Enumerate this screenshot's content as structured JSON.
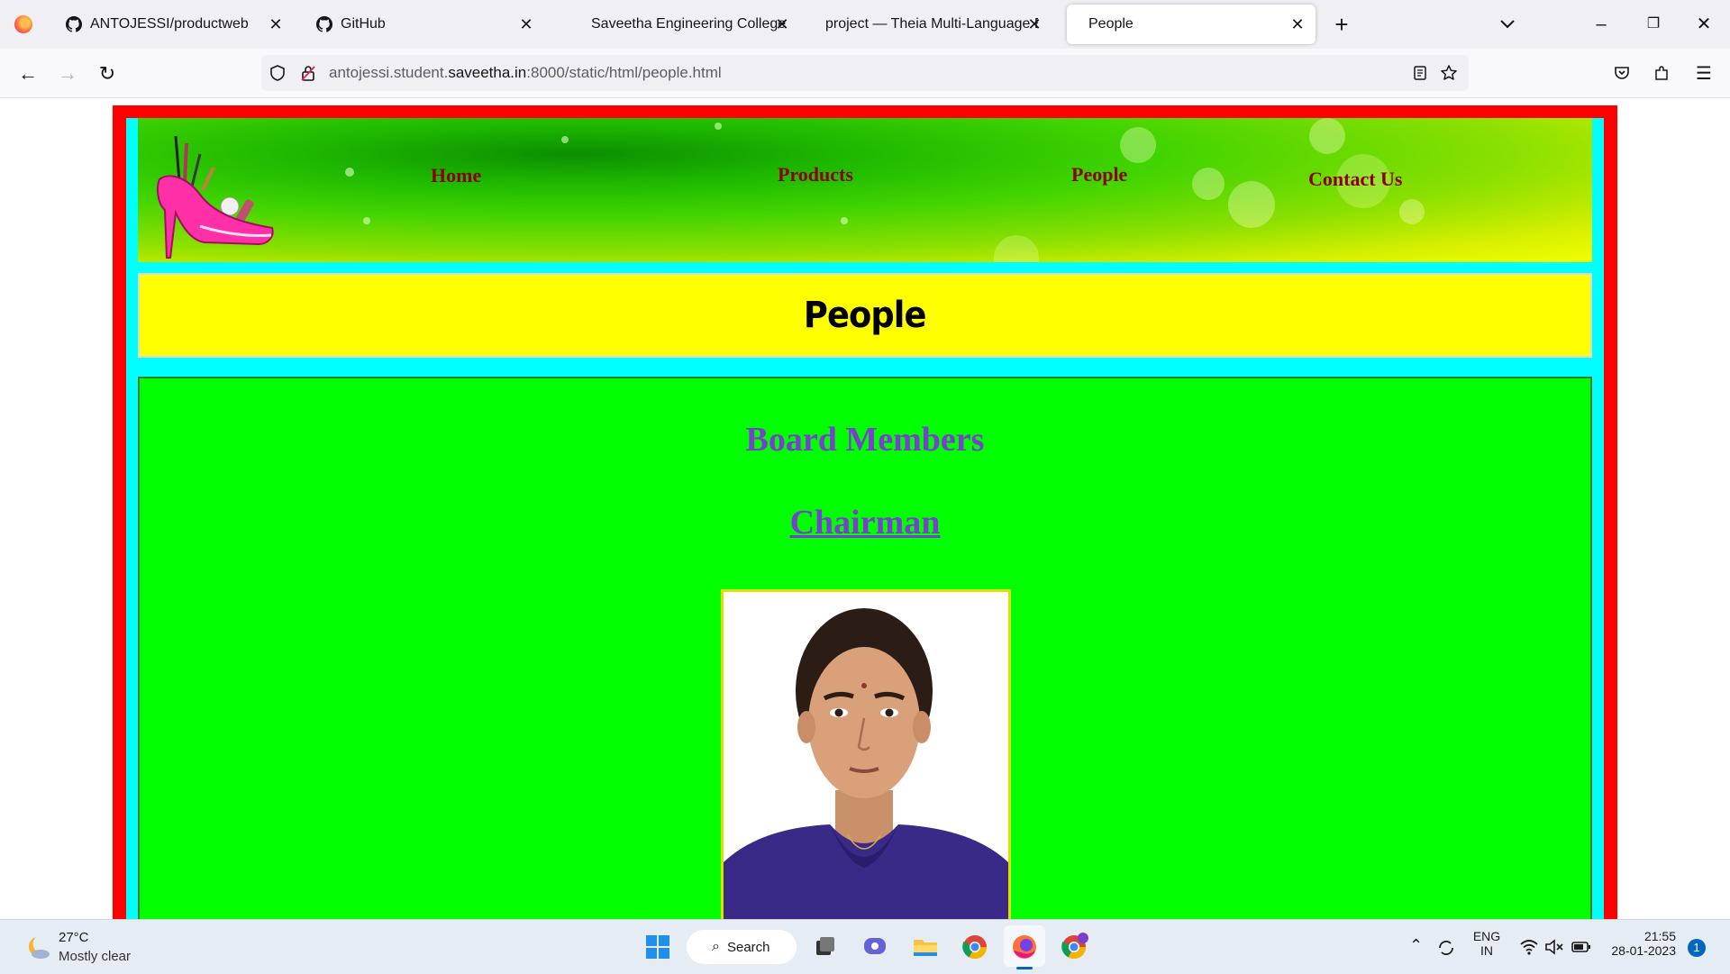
{
  "browser": {
    "tabs": [
      {
        "title": "ANTOJESSI/productweb",
        "icon": "github-icon",
        "active": false
      },
      {
        "title": "GitHub",
        "icon": "github-icon",
        "active": false
      },
      {
        "title": "Saveetha Engineering College",
        "icon": "none",
        "active": false
      },
      {
        "title": "project — Theia Multi-Language Ex",
        "icon": "none",
        "active": false
      },
      {
        "title": "People",
        "icon": "none",
        "active": true
      }
    ],
    "url": {
      "prefix": "antojessi.student.",
      "domain": "saveetha.in",
      "suffix": ":8000/static/html/people.html"
    }
  },
  "site": {
    "menu": [
      "Home",
      "Products",
      "People",
      "Contact Us"
    ],
    "page_title": "People",
    "section_title": "Board Members",
    "role_title": "Chairman"
  },
  "taskbar": {
    "weather_temp": "27°C",
    "weather_desc": "Mostly clear",
    "search_label": "Search",
    "lang_top": "ENG",
    "lang_bottom": "IN",
    "time": "21:55",
    "date": "28-01-2023",
    "notifications": "1"
  },
  "colors": {
    "outer_frame": "#ff0000",
    "inner_frame": "#00ffff",
    "title_bar": "#ffff00",
    "content_bg": "#00ff00",
    "menu_text": "#8b0000",
    "heading_text": "#7a3fd0"
  }
}
